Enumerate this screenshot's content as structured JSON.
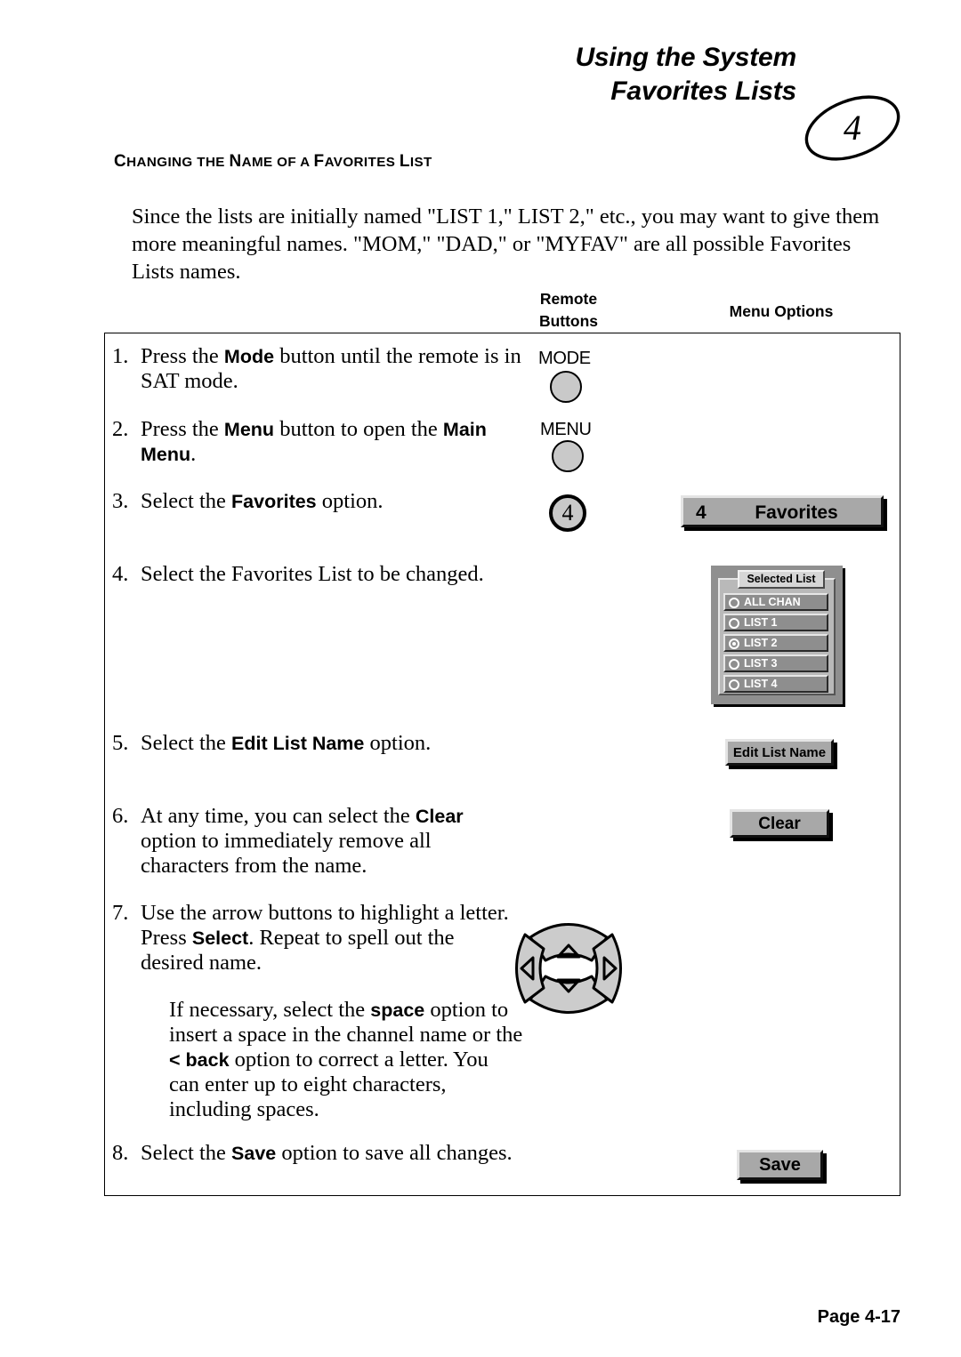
{
  "header": {
    "line1": "Using the System",
    "line2": "Favorites Lists",
    "chapter_number": "4"
  },
  "section": {
    "heading_parts": [
      {
        "text": "C",
        "caps": true
      },
      {
        "text": "HANGING THE ",
        "caps": false
      },
      {
        "text": "N",
        "caps": true
      },
      {
        "text": "AME OF A ",
        "caps": false
      },
      {
        "text": "F",
        "caps": true
      },
      {
        "text": "AVORITES ",
        "caps": false
      },
      {
        "text": "L",
        "caps": true
      },
      {
        "text": "IST",
        "caps": false
      }
    ],
    "heading_plain": "CHANGING THE NAME OF A FAVORITES LIST",
    "intro": "Since the lists are initially named \"LIST 1,\" LIST 2,\" etc., you may want to give them more meaningful names.  \"MOM,\" \"DAD,\" or \"MYFAV\" are all possible Favorites Lists names."
  },
  "columns": {
    "remote_buttons": "Remote\nButtons",
    "remote_line1": "Remote",
    "remote_line2": "Buttons",
    "menu_options": "Menu Options"
  },
  "steps": [
    {
      "number": "1.",
      "segments": [
        {
          "text": "Press the ",
          "bold": false
        },
        {
          "text": "Mode",
          "bold": true
        },
        {
          "text": " button until the remote is in SAT mode.",
          "bold": false
        }
      ]
    },
    {
      "number": "2.",
      "segments": [
        {
          "text": "Press the ",
          "bold": false
        },
        {
          "text": "Menu",
          "bold": true
        },
        {
          "text": " button to open the ",
          "bold": false
        },
        {
          "text": "Main Menu",
          "bold": true
        },
        {
          "text": ".",
          "bold": false
        }
      ]
    },
    {
      "number": "3.",
      "segments": [
        {
          "text": "Select the ",
          "bold": false
        },
        {
          "text": "Favorites",
          "bold": true
        },
        {
          "text": " option.",
          "bold": false
        }
      ]
    },
    {
      "number": "4.",
      "segments": [
        {
          "text": "Select the Favorites List to be changed.",
          "bold": false
        }
      ]
    },
    {
      "number": "5.",
      "segments": [
        {
          "text": "Select the ",
          "bold": false
        },
        {
          "text": "Edit List Name",
          "bold": true
        },
        {
          "text": " option.",
          "bold": false
        }
      ]
    },
    {
      "number": "6.",
      "segments": [
        {
          "text": "At any time, you can select the ",
          "bold": false
        },
        {
          "text": "Clear",
          "bold": true
        },
        {
          "text": " option to immediately remove all characters from the name.",
          "bold": false
        }
      ]
    },
    {
      "number": "7.",
      "segments": [
        {
          "text": "Use the arrow buttons to highlight a letter. Press ",
          "bold": false
        },
        {
          "text": "Select",
          "bold": true
        },
        {
          "text": ".  Repeat to spell out the desired name.",
          "bold": false
        }
      ]
    },
    {
      "number": "",
      "segments": [
        {
          "text": "If necessary, select the ",
          "bold": false
        },
        {
          "text": "space",
          "bold": true
        },
        {
          "text": " option to insert a space in the channel name or the ",
          "bold": false
        },
        {
          "text": "< back",
          "bold": true
        },
        {
          "text": " option to correct a letter. You can enter up to eight characters, including spaces.",
          "bold": false
        }
      ]
    },
    {
      "number": "8.",
      "segments": [
        {
          "text": "Select the ",
          "bold": false
        },
        {
          "text": "Save",
          "bold": true
        },
        {
          "text": " option to save all changes.",
          "bold": false
        }
      ]
    }
  ],
  "remote": {
    "mode_label": "MODE",
    "menu_label": "MENU",
    "four_label": "4",
    "arrow_pad_name": "arrow-pad"
  },
  "menu_widgets": {
    "favorites_number": "4",
    "favorites_label": "Favorites",
    "edit_list_name_label": "Edit List Name",
    "clear_label": "Clear",
    "save_label": "Save",
    "selected_list": {
      "title": "Selected List",
      "items": [
        {
          "label": "ALL CHAN",
          "selected": false
        },
        {
          "label": "LIST 1",
          "selected": false
        },
        {
          "label": "LIST 2",
          "selected": true
        },
        {
          "label": "LIST 3",
          "selected": false
        },
        {
          "label": "LIST 4",
          "selected": false
        }
      ]
    }
  },
  "footer": {
    "page": "Page 4-17"
  },
  "colors": {
    "button_face": "#a8a8a8",
    "button_highlight": "#e4e4e4",
    "button_shadow": "#111111",
    "panel_outer": "#8f8f8f",
    "panel_inner": "#b9b9b9",
    "item_face": "#8e8e8e",
    "remote_button_fill": "#c9c9c9",
    "text": "#000000"
  }
}
